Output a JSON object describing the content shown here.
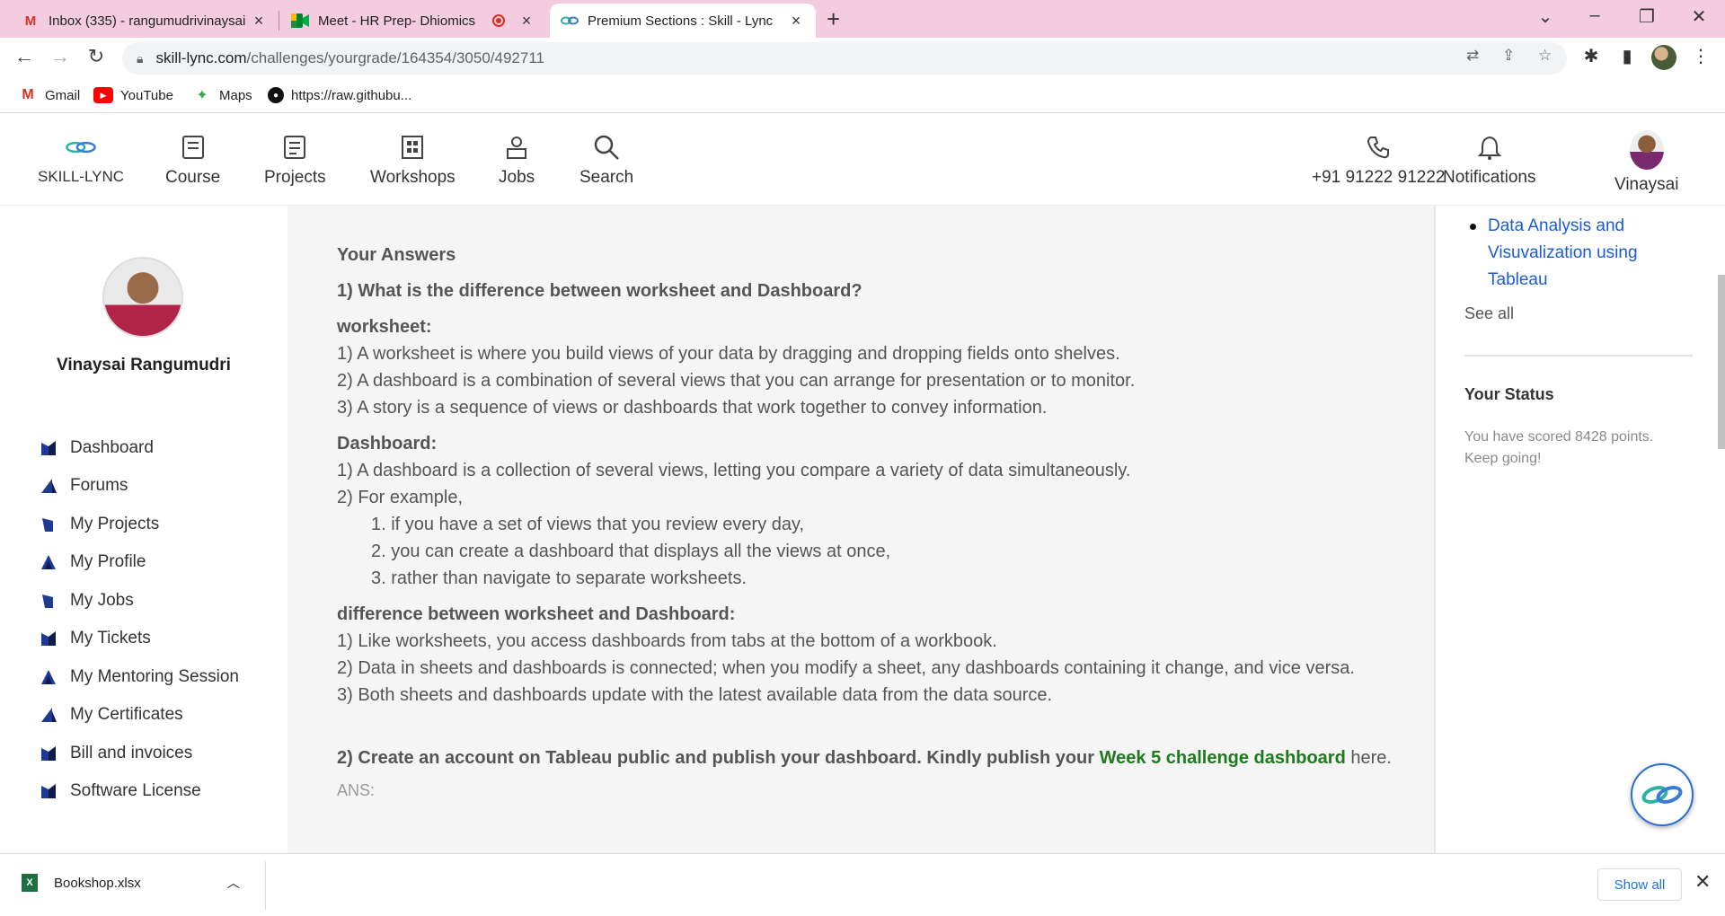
{
  "browser": {
    "tabs": [
      {
        "title": "Inbox (335) - rangumudrivinaysai",
        "favicon": "gmail"
      },
      {
        "title": "Meet - HR Prep- Dhiomics",
        "favicon": "meet"
      },
      {
        "title": "Premium Sections : Skill - Lync",
        "favicon": "skill-lync",
        "active": true
      }
    ],
    "url_host": "skill-lync.com",
    "url_path": "/challenges/yourgrade/164354/3050/492711",
    "bookmarks": [
      {
        "label": "Gmail"
      },
      {
        "label": "YouTube"
      },
      {
        "label": "Maps"
      },
      {
        "label": "https://raw.githubu..."
      }
    ]
  },
  "site_header": {
    "brand": "SKILL-LYNC",
    "nav": [
      "Course",
      "Projects",
      "Workshops",
      "Jobs",
      "Search"
    ],
    "phone": "+91 91222 91222",
    "notifications": "Notifications",
    "user": "Vinaysai"
  },
  "sidebar": {
    "profile_name": "Vinaysai Rangumudri",
    "items": [
      {
        "label": "Dashboard"
      },
      {
        "label": "Forums"
      },
      {
        "label": "My Projects"
      },
      {
        "label": "My Profile"
      },
      {
        "label": "My Jobs"
      },
      {
        "label": "My Tickets"
      },
      {
        "label": "My Mentoring Session"
      },
      {
        "label": "My Certificates"
      },
      {
        "label": "Bill and invoices"
      },
      {
        "label": "Software License"
      }
    ]
  },
  "main": {
    "heading": "Your Answers",
    "q1": "1) What is the difference between worksheet and Dashboard?",
    "worksheet_title": "worksheet:",
    "worksheet_lines": [
      "1) A worksheet is where you build views of your data by dragging and dropping fields onto shelves.",
      "2) A dashboard is a combination of several views that you can arrange for presentation or to monitor.",
      "3) A story is a sequence of views or dashboards that work together to convey information."
    ],
    "dashboard_title": "Dashboard:",
    "dashboard_lines": [
      "1) A dashboard is a collection of several views, letting you compare a variety of data simultaneously.",
      "2) For example,"
    ],
    "dashboard_sublines": [
      "1. if you have a set of views that you review every day,",
      "2. you can create a dashboard that displays all the views at once,",
      "3. rather than navigate to separate worksheets."
    ],
    "diff_title": "difference between worksheet and Dashboard:",
    "diff_lines": [
      "1) Like worksheets, you access dashboards from tabs at the bottom of a workbook.",
      "2) Data in sheets and dashboards is connected; when you modify a sheet, any dashboards containing it change, and vice versa.",
      "3) Both sheets and dashboards update with the latest available data from the data source."
    ],
    "q2_prefix": "2) Create an account on Tableau public and publish your dashboard. Kindly publish your ",
    "q2_link": "Week 5 challenge dashboard",
    "q2_suffix": " here.",
    "ans_partial": "ANS:"
  },
  "right_sidebar": {
    "link": "Data Analysis and Visuvalization using Tableau",
    "see_all": "See all",
    "status_title": "Your Status",
    "status_text": "You have scored 8428 points. Keep going!"
  },
  "download": {
    "filename": "Bookshop.xlsx",
    "show_all": "Show all"
  },
  "colors": {
    "tabstrip": "#f4cce0",
    "link_blue": "#1a5bd6",
    "green_link": "#1f7a1f"
  }
}
